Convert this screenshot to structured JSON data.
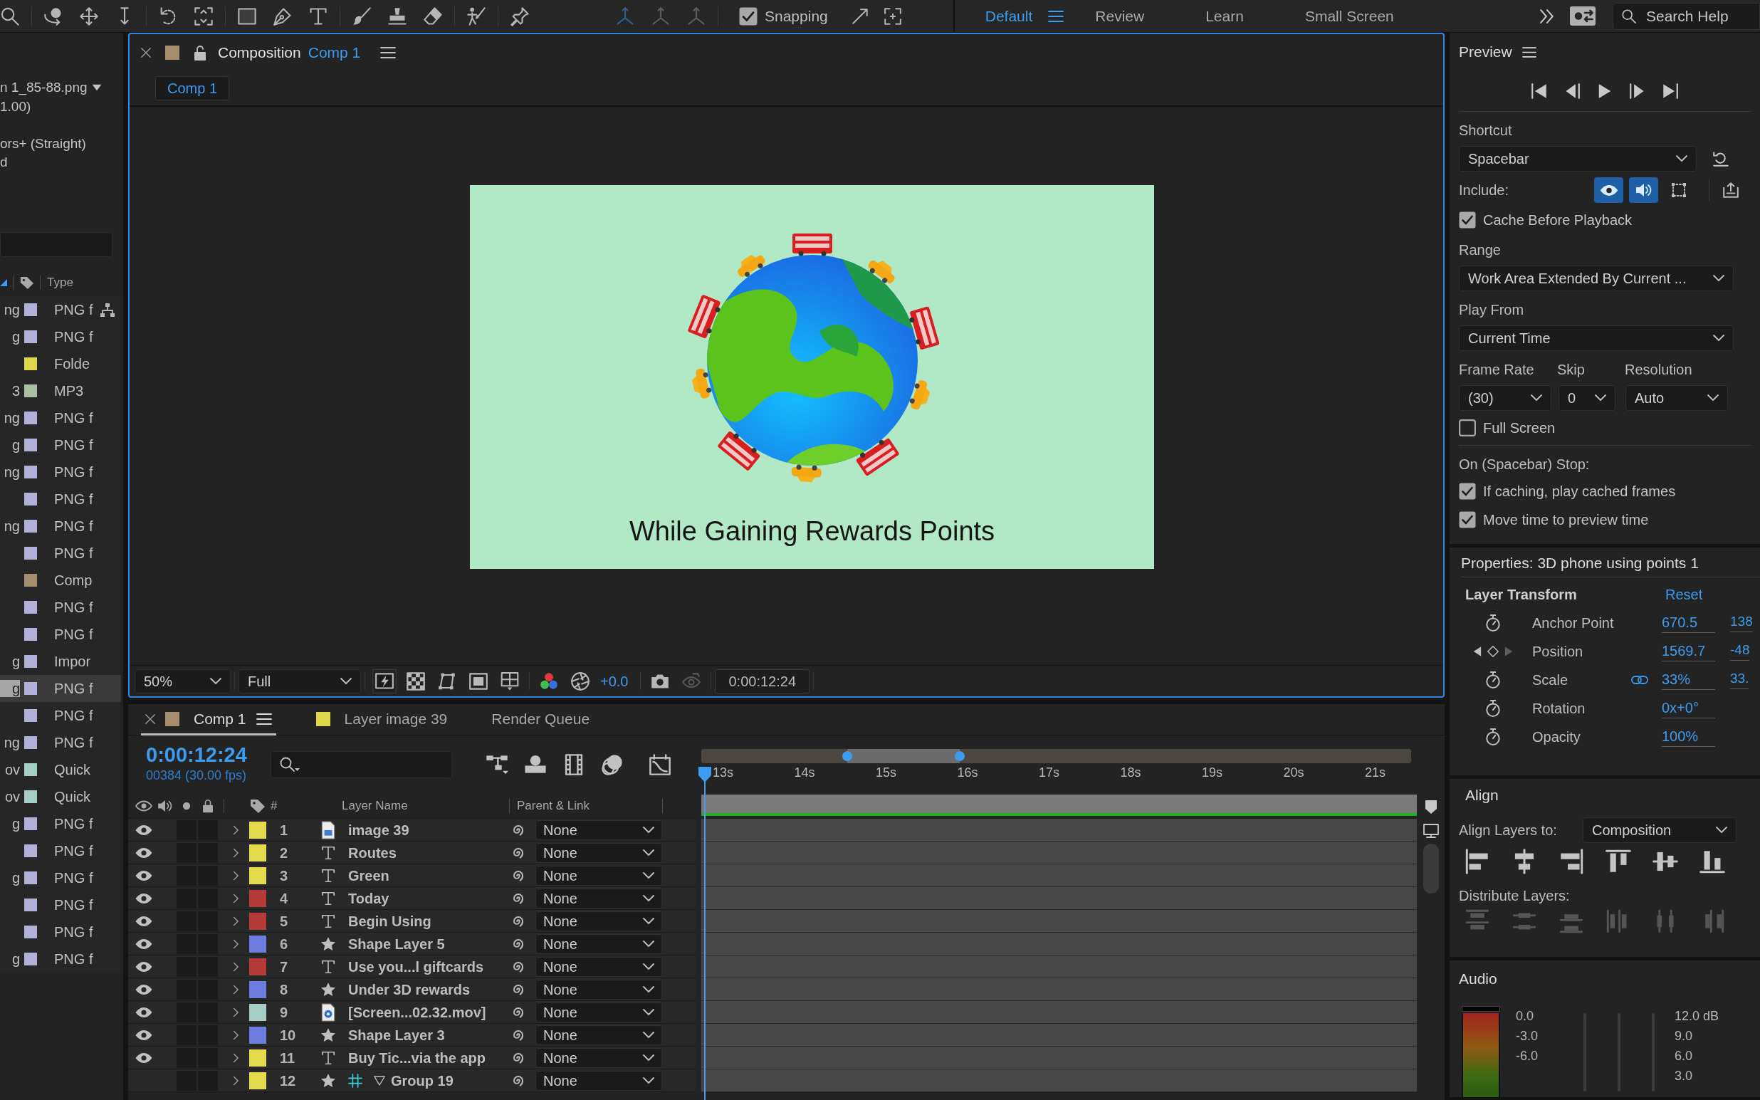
{
  "toolbar": {
    "snapping": {
      "label": "Snapping",
      "checked": true
    },
    "workspaces": [
      {
        "label": "Default",
        "selected": true
      },
      {
        "label": "Review",
        "selected": false
      },
      {
        "label": "Learn",
        "selected": false
      },
      {
        "label": "Small Screen",
        "selected": false
      }
    ],
    "search": {
      "placeholder": "Search Help"
    }
  },
  "project": {
    "info_lines": [
      "n 1_85-88.png",
      "1.00)",
      "ors+ (Straight)",
      "d"
    ],
    "type_column": "Type",
    "items": [
      {
        "name": "ng",
        "color": "#b1b1da",
        "type": "PNG f",
        "selected": false
      },
      {
        "name": "g",
        "color": "#b1b1da",
        "type": "PNG f",
        "selected": false
      },
      {
        "color": "#e0d64c",
        "type": "Folde",
        "selected": false
      },
      {
        "name": "3",
        "color": "#a9c0a5",
        "type": "MP3",
        "selected": false
      },
      {
        "name": "ng",
        "color": "#b1b1da",
        "type": "PNG f",
        "selected": false
      },
      {
        "name": "g",
        "color": "#b1b1da",
        "type": "PNG f",
        "selected": false
      },
      {
        "name": "ng",
        "color": "#b1b1da",
        "type": "PNG f",
        "selected": false
      },
      {
        "color": "#b1b1da",
        "type": "PNG f",
        "selected": false
      },
      {
        "name": "ng",
        "color": "#b1b1da",
        "type": "PNG f",
        "selected": false
      },
      {
        "color": "#b1b1da",
        "type": "PNG f",
        "selected": false
      },
      {
        "color": "#a58e6d",
        "type": "Comp",
        "selected": false
      },
      {
        "color": "#b1b1da",
        "type": "PNG f",
        "selected": false
      },
      {
        "color": "#b1b1da",
        "type": "PNG f",
        "selected": false
      },
      {
        "name": "g",
        "color": "#b1b1da",
        "type": "Impor",
        "selected": false
      },
      {
        "name": "g",
        "color": "#b1b1da",
        "type": "PNG f",
        "selected": true
      },
      {
        "color": "#b1b1da",
        "type": "PNG f",
        "selected": false
      },
      {
        "name": "ng",
        "color": "#b1b1da",
        "type": "PNG f",
        "selected": false
      },
      {
        "name": "ov",
        "color": "#a4cec6",
        "type": "Quick",
        "selected": false
      },
      {
        "name": "ov",
        "color": "#a4cec6",
        "type": "Quick",
        "selected": false
      },
      {
        "name": "g",
        "color": "#b1b1da",
        "type": "PNG f",
        "selected": false
      },
      {
        "color": "#b1b1da",
        "type": "PNG f",
        "selected": false
      },
      {
        "name": "g",
        "color": "#b1b1da",
        "type": "PNG f",
        "selected": false
      },
      {
        "color": "#b1b1da",
        "type": "PNG f",
        "selected": false
      },
      {
        "color": "#b1b1da",
        "type": "PNG f",
        "selected": false
      },
      {
        "name": "g",
        "color": "#b1b1da",
        "type": "PNG f",
        "selected": false
      }
    ]
  },
  "composition": {
    "panel_title": "Composition",
    "comp_name": "Comp 1",
    "tabs": [
      {
        "label": "Comp 1",
        "selected": true
      }
    ],
    "caption": "While Gaining Rewards Points",
    "zoom": "50%",
    "resolution": "Full",
    "exposure": "+0.0",
    "timecode": "0:00:12:24"
  },
  "timeline": {
    "tabs": [
      {
        "label": "Comp 1",
        "color": "#a58e6d",
        "selected": true
      },
      {
        "label": "Layer image 39",
        "color": "#e0d64c",
        "selected": false
      },
      {
        "label": "Render Queue",
        "selected": false
      }
    ],
    "timecode": "0:00:12:24",
    "frame_info": "00384 (30.00 fps)",
    "ruler": [
      "13s",
      "14s",
      "15s",
      "16s",
      "17s",
      "18s",
      "19s",
      "20s",
      "21s"
    ],
    "columns": {
      "number": "#",
      "name": "Layer Name",
      "parent": "Parent & Link"
    },
    "layers": [
      {
        "number": "1",
        "kind": "footage",
        "name": "image 39",
        "color": "#e4da4e",
        "visible": true,
        "solo": false,
        "locked": false,
        "parent": "None"
      },
      {
        "number": "2",
        "kind": "text",
        "name": "Routes",
        "color": "#e4da4e",
        "visible": true,
        "solo": false,
        "locked": false,
        "parent": "None"
      },
      {
        "number": "3",
        "kind": "text",
        "name": "Green",
        "color": "#e4da4e",
        "visible": true,
        "solo": false,
        "locked": false,
        "parent": "None"
      },
      {
        "number": "4",
        "kind": "text",
        "name": "Today",
        "color": "#b53a3a",
        "visible": true,
        "solo": false,
        "locked": false,
        "parent": "None"
      },
      {
        "number": "5",
        "kind": "text",
        "name": "Begin Using",
        "color": "#b53a3a",
        "visible": true,
        "solo": false,
        "locked": false,
        "parent": "None"
      },
      {
        "number": "6",
        "kind": "shape",
        "name": "Shape Layer 5",
        "color": "#6b7ee0",
        "visible": true,
        "solo": false,
        "locked": false,
        "parent": "None"
      },
      {
        "number": "7",
        "kind": "text",
        "name": "Use you...l giftcards",
        "color": "#b53a3a",
        "visible": true,
        "solo": false,
        "locked": false,
        "parent": "None"
      },
      {
        "number": "8",
        "kind": "shape",
        "name": "Under 3D rewards",
        "color": "#6b7ee0",
        "visible": true,
        "solo": false,
        "locked": false,
        "parent": "None"
      },
      {
        "number": "9",
        "kind": "movie",
        "name": "[Screen...02.32.mov]",
        "color": "#a4cec6",
        "visible": true,
        "solo": false,
        "locked": false,
        "parent": "None"
      },
      {
        "number": "10",
        "kind": "shape",
        "name": "Shape Layer 3",
        "color": "#6b7ee0",
        "visible": true,
        "solo": false,
        "locked": false,
        "parent": "None"
      },
      {
        "number": "11",
        "kind": "text",
        "name": "Buy Tic...via the app",
        "color": "#e4da4e",
        "visible": true,
        "solo": false,
        "locked": false,
        "parent": "None"
      },
      {
        "number": "12",
        "kind": "shape_group",
        "name": "Group 19",
        "color": "#e4da4e",
        "visible": false,
        "solo": false,
        "locked": false,
        "parent": "None"
      }
    ]
  },
  "preview": {
    "title": "Preview",
    "shortcut_label": "Shortcut",
    "shortcut": "Spacebar",
    "include_label": "Include:",
    "include": [
      {
        "kind": "video",
        "on": true
      },
      {
        "kind": "audio",
        "on": true
      },
      {
        "kind": "overlay",
        "on": false
      }
    ],
    "cache": {
      "label": "Cache Before Playback",
      "checked": true
    },
    "range_label": "Range",
    "range": "Work Area Extended By Current ...",
    "play_from_label": "Play From",
    "play_from": "Current Time",
    "frame_rate_label": "Frame Rate",
    "frame_rate": "(30)",
    "skip_label": "Skip",
    "skip": "0",
    "resolution_label": "Resolution",
    "resolution": "Auto",
    "full_screen": {
      "label": "Full Screen",
      "checked": false
    },
    "stop_label": "On (Spacebar) Stop:",
    "stop_options": [
      {
        "label": "If caching, play cached frames",
        "checked": true
      },
      {
        "label": "Move time to preview time",
        "checked": true
      }
    ]
  },
  "properties": {
    "title": "Properties: 3D phone using points 1",
    "section": "Layer Transform",
    "reset": "Reset",
    "rows": [
      {
        "kind": "stopwatch",
        "label": "Anchor Point",
        "linked": false,
        "values": [
          "670.5",
          "138"
        ]
      },
      {
        "kind": "keyframes",
        "label": "Position",
        "linked": false,
        "values": [
          "1569.7",
          "-48"
        ]
      },
      {
        "kind": "stopwatch",
        "label": "Scale",
        "linked": true,
        "values": [
          "33%",
          "33."
        ]
      },
      {
        "kind": "stopwatch",
        "label": "Rotation",
        "linked": false,
        "values": [
          "0x+0°"
        ]
      },
      {
        "kind": "stopwatch",
        "label": "Opacity",
        "linked": false,
        "values": [
          "100%"
        ]
      }
    ]
  },
  "align": {
    "title": "Align",
    "align_to_label": "Align Layers to:",
    "align_to": "Composition",
    "distribute_label": "Distribute Layers:",
    "distribute_enabled": false
  },
  "audio": {
    "title": "Audio",
    "left_scale": [
      "0.0",
      "-3.0",
      "-6.0"
    ],
    "right_scale": [
      "12.0 dB",
      "9.0",
      "6.0",
      "3.0"
    ]
  }
}
